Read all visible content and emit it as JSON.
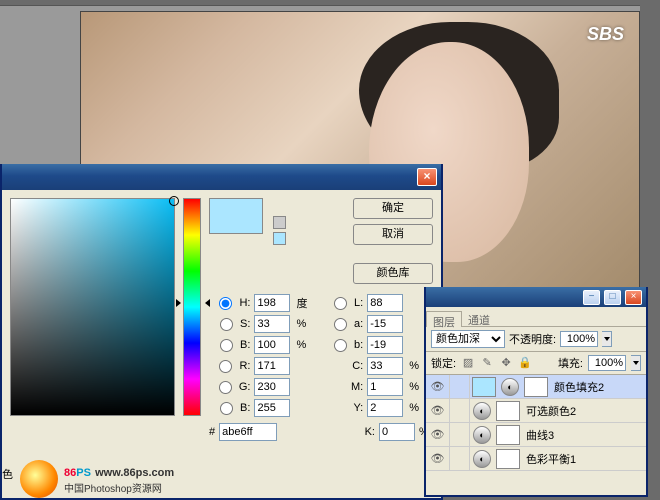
{
  "watermark": {
    "brand_86": "86",
    "brand_ps": "PS",
    "url": "www.86ps.com",
    "sub": "中国Photoshop资源网"
  },
  "sbs": "SBS",
  "color_picker": {
    "close": "×",
    "buttons": {
      "ok": "确定",
      "cancel": "取消",
      "lib": "颜色库"
    },
    "preview_hex": "#abe6ff",
    "fields": {
      "H": {
        "label": "H:",
        "val": "198",
        "unit": "度"
      },
      "S": {
        "label": "S:",
        "val": "33",
        "unit": "%"
      },
      "Bv": {
        "label": "B:",
        "val": "100",
        "unit": "%"
      },
      "R": {
        "label": "R:",
        "val": "171"
      },
      "G": {
        "label": "G:",
        "val": "230"
      },
      "Bb": {
        "label": "B:",
        "val": "255"
      },
      "L": {
        "label": "L:",
        "val": "88"
      },
      "a": {
        "label": "a:",
        "val": "-15"
      },
      "b": {
        "label": "b:",
        "val": "-19"
      },
      "C": {
        "label": "C:",
        "val": "33",
        "unit": "%"
      },
      "M": {
        "label": "M:",
        "val": "1",
        "unit": "%"
      },
      "Y": {
        "label": "Y:",
        "val": "2",
        "unit": "%"
      },
      "K": {
        "label": "K:",
        "val": "0",
        "unit": "%"
      }
    },
    "hex": {
      "label": "#",
      "val": "abe6ff"
    }
  },
  "layers": {
    "tabs": {
      "layers": "图层",
      "channels": "通道"
    },
    "blend_mode": "颜色加深",
    "opacity": {
      "label": "不透明度:",
      "val": "100%"
    },
    "fill": {
      "label": "填充:",
      "val": "100%"
    },
    "lock_label": "锁定:",
    "close": "×",
    "minus": "−",
    "win": "□",
    "items": [
      {
        "name": "颜色填充2",
        "thumb": "#abe6ff",
        "selected": true
      },
      {
        "name": "可选颜色2",
        "thumb": "#c0c0c0"
      },
      {
        "name": "曲线3",
        "thumb": "#c0c0c0"
      },
      {
        "name": "色彩平衡1",
        "thumb": "#c0c0c0"
      }
    ]
  },
  "status": "色"
}
